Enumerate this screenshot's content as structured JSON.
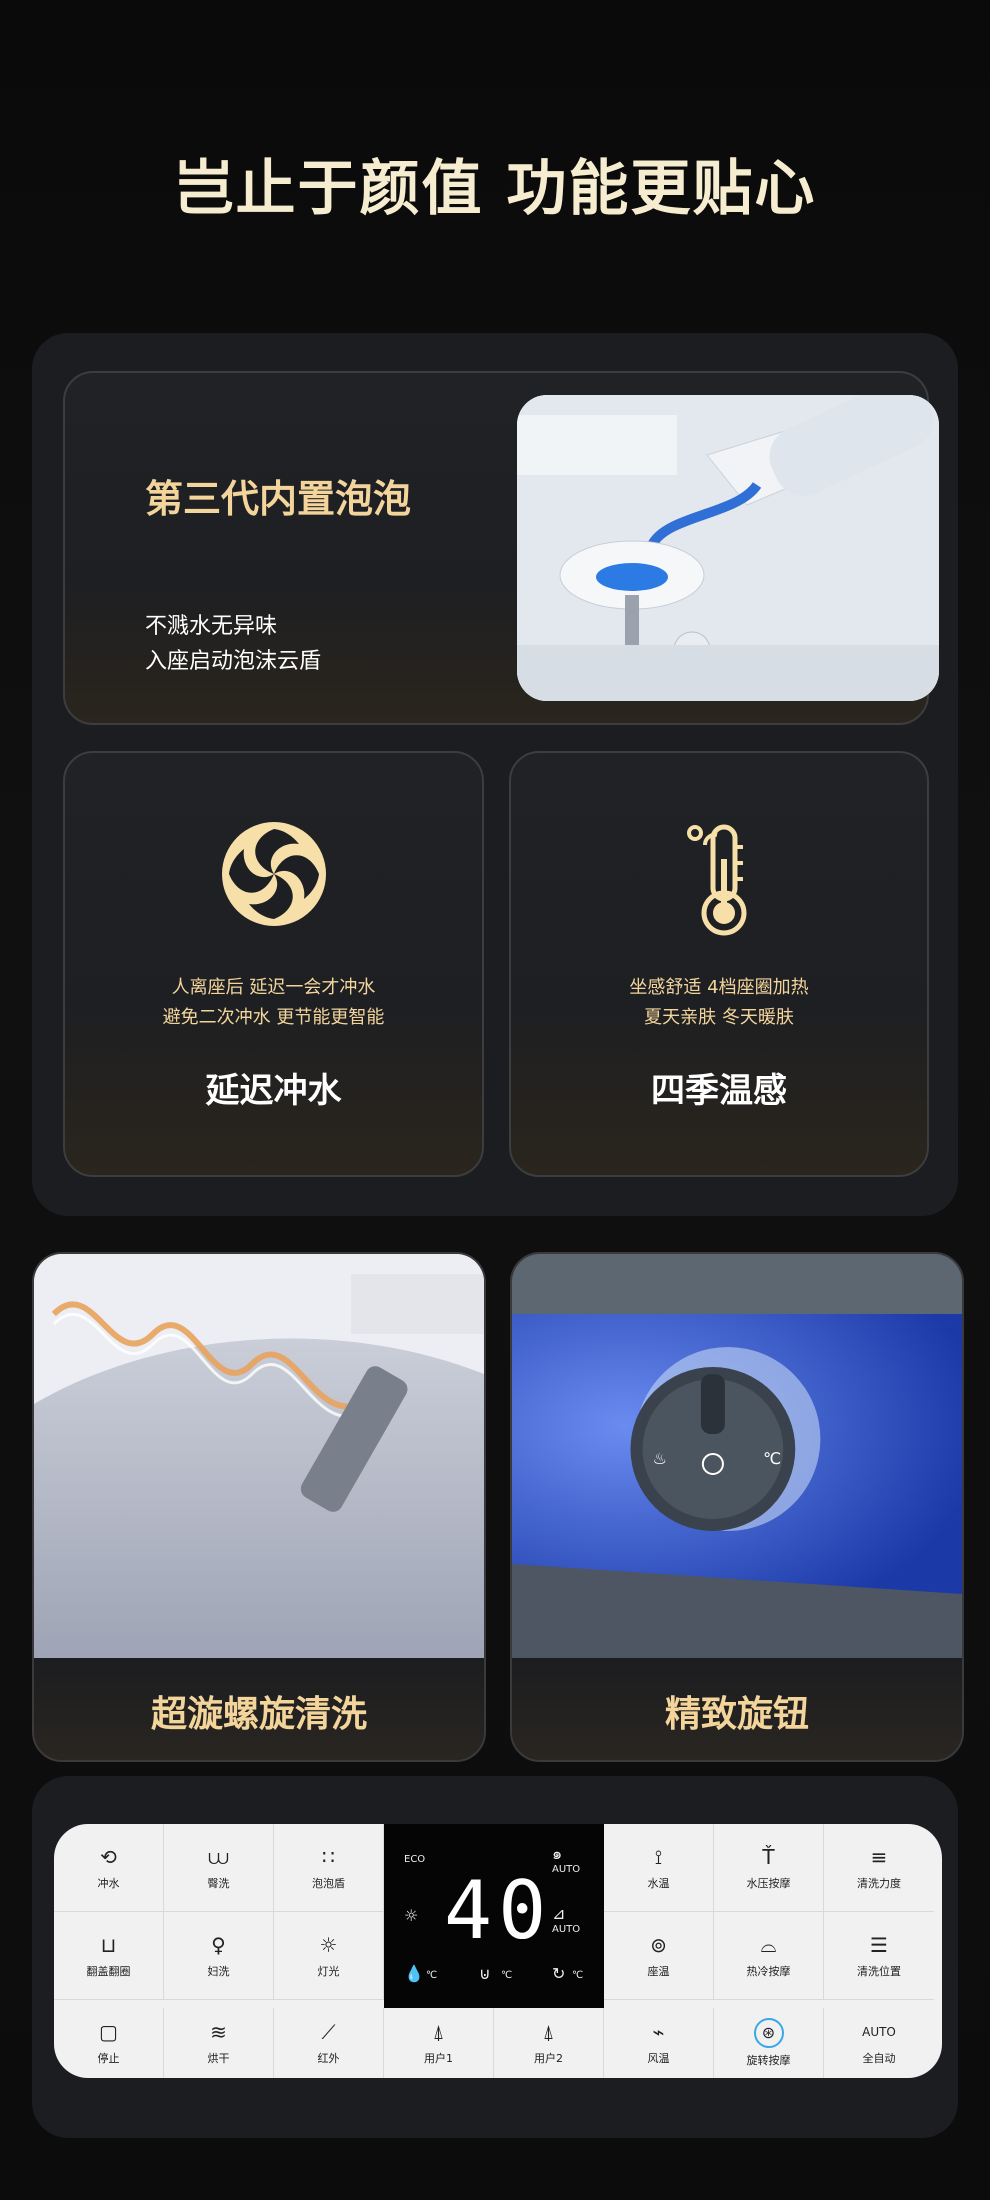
{
  "title": "岂止于颜值 功能更贴心",
  "hero": {
    "title": "第三代内置泡泡",
    "lines": [
      "不溅水无异味",
      "入座启动泡沫云盾"
    ]
  },
  "features": [
    {
      "desc1": "人离座后 延迟一会才冲水",
      "desc2": "避免二次冲水 更节能更智能",
      "title": "延迟冲水"
    },
    {
      "desc1": "坐感舒适 4档座圈加热",
      "desc2": "夏天亲肤 冬天暖肤",
      "title": "四季温感"
    }
  ],
  "photos": [
    {
      "caption": "超漩螺旋清洗"
    },
    {
      "caption": "精致旋钮"
    }
  ],
  "remote": {
    "left_top": [
      {
        "icon": "flush-icon",
        "label": "冲水"
      },
      {
        "icon": "hip-wash-icon",
        "label": "臀洗"
      },
      {
        "icon": "foam-shield-icon",
        "label": "泡泡盾"
      }
    ],
    "left_mid": [
      {
        "icon": "lid-flip-icon",
        "label": "翻盖翻圈"
      },
      {
        "icon": "feminine-wash-icon",
        "label": "妇洗"
      },
      {
        "icon": "light-icon",
        "label": "灯光"
      }
    ],
    "right_top": [
      {
        "icon": "water-temp-icon",
        "label": "水温"
      },
      {
        "icon": "pressure-massage-icon",
        "label": "水压按摩"
      },
      {
        "icon": "clean-strength-icon",
        "label": "清洗力度"
      }
    ],
    "right_mid": [
      {
        "icon": "seat-temp-icon",
        "label": "座温"
      },
      {
        "icon": "hot-cold-massage-icon",
        "label": "热冷按摩"
      },
      {
        "icon": "clean-position-icon",
        "label": "清洗位置"
      }
    ],
    "bottom": [
      {
        "icon": "stop-icon",
        "label": "停止"
      },
      {
        "icon": "dry-icon",
        "label": "烘干"
      },
      {
        "icon": "infrared-icon",
        "label": "红外"
      },
      {
        "icon": "user-icon",
        "label": "用户1"
      },
      {
        "icon": "user-icon",
        "label": "用户2"
      },
      {
        "icon": "air-temp-icon",
        "label": "风温"
      },
      {
        "icon": "rotate-massage-icon",
        "label": "旋转按摩"
      },
      {
        "icon": "auto-text",
        "label": "全自动",
        "top_text": "AUTO"
      }
    ],
    "lcd": {
      "eco": "ECO",
      "value": "40",
      "auto1": "AUTO",
      "auto2": "AUTO",
      "c1": "℃",
      "c2": "℃",
      "c3": "℃"
    }
  },
  "colors": {
    "accent": "#f3d59c",
    "panel": "#1c1d20",
    "background": "#0b0b0b"
  }
}
